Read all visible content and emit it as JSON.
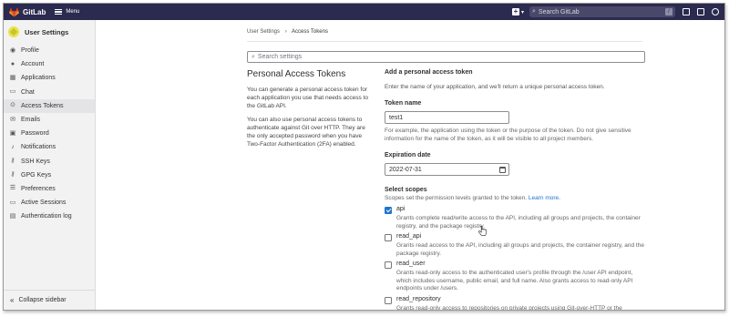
{
  "topbar": {
    "brand": "GitLab",
    "menu_label": "Menu",
    "search_placeholder": "Search GitLab",
    "search_shortcut": "/",
    "colors": {
      "bg": "#2b2a4f",
      "logo": "#fc6d26"
    }
  },
  "sidebar": {
    "title": "User Settings",
    "items": [
      {
        "label": "Profile",
        "icon": "profile-icon"
      },
      {
        "label": "Account",
        "icon": "account-icon"
      },
      {
        "label": "Applications",
        "icon": "applications-icon"
      },
      {
        "label": "Chat",
        "icon": "chat-icon"
      },
      {
        "label": "Access Tokens",
        "icon": "token-icon",
        "active": true
      },
      {
        "label": "Emails",
        "icon": "mail-icon"
      },
      {
        "label": "Password",
        "icon": "lock-icon"
      },
      {
        "label": "Notifications",
        "icon": "bell-icon"
      },
      {
        "label": "SSH Keys",
        "icon": "key-icon"
      },
      {
        "label": "GPG Keys",
        "icon": "key-icon"
      },
      {
        "label": "Preferences",
        "icon": "preferences-icon"
      },
      {
        "label": "Active Sessions",
        "icon": "monitor-icon"
      },
      {
        "label": "Authentication log",
        "icon": "log-icon"
      }
    ],
    "collapse_label": "Collapse sidebar"
  },
  "breadcrumb": {
    "parent": "User Settings",
    "current": "Access Tokens"
  },
  "search": {
    "placeholder": "Search settings"
  },
  "intro": {
    "title": "Personal Access Tokens",
    "p1": "You can generate a personal access token for each application you use that needs access to the GitLab API.",
    "p2": "You can also use personal access tokens to authenticate against Git over HTTP. They are the only accepted password when you have Two-Factor Authentication (2FA) enabled."
  },
  "form": {
    "section_title": "Add a personal access token",
    "section_desc": "Enter the name of your application, and we'll return a unique personal access token.",
    "name_label": "Token name",
    "name_value": "test1",
    "name_help": "For example, the application using the token or the purpose of the token. Do not give sensitive information for the name of the token, as it will be visible to all project members.",
    "expiry_label": "Expiration date",
    "expiry_value": "2022-07-31",
    "scopes_label": "Select scopes",
    "scopes_help": "Scopes set the permission levels granted to the token.",
    "scopes_link": "Learn more.",
    "scopes": [
      {
        "name": "api",
        "checked": true,
        "desc": "Grants complete read/write access to the API, including all groups and projects, the container registry, and the package registry."
      },
      {
        "name": "read_api",
        "checked": false,
        "desc": "Grants read access to the API, including all groups and projects, the container registry, and the package registry."
      },
      {
        "name": "read_user",
        "checked": false,
        "desc": "Grants read-only access to the authenticated user's profile through the /user API endpoint, which includes username, public email, and full name. Also grants access to read-only API endpoints under /users."
      },
      {
        "name": "read_repository",
        "checked": false,
        "desc": "Grants read-only access to repositories on private projects using Git-over-HTTP or the Repository Files API."
      }
    ]
  }
}
